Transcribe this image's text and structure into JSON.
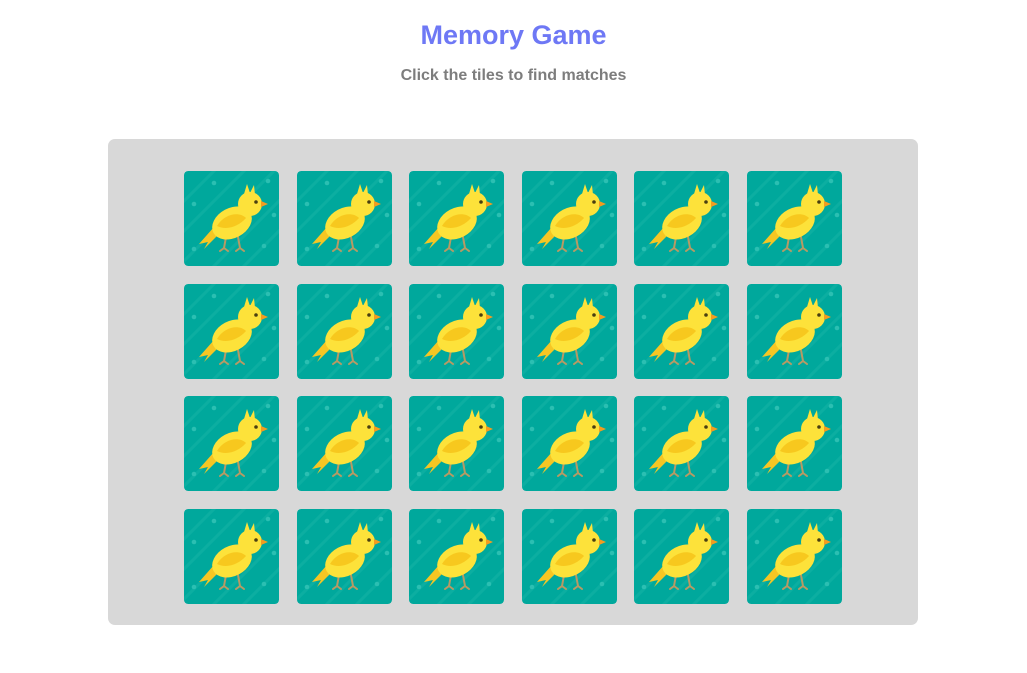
{
  "header": {
    "title": "Memory Game",
    "subtitle": "Click the tiles to find matches"
  },
  "board": {
    "rows": 4,
    "columns": 6,
    "tiles": [
      {
        "face": "down",
        "back_icon": "canary-bird-icon"
      },
      {
        "face": "down",
        "back_icon": "canary-bird-icon"
      },
      {
        "face": "down",
        "back_icon": "canary-bird-icon"
      },
      {
        "face": "down",
        "back_icon": "canary-bird-icon"
      },
      {
        "face": "down",
        "back_icon": "canary-bird-icon"
      },
      {
        "face": "down",
        "back_icon": "canary-bird-icon"
      },
      {
        "face": "down",
        "back_icon": "canary-bird-icon"
      },
      {
        "face": "down",
        "back_icon": "canary-bird-icon"
      },
      {
        "face": "down",
        "back_icon": "canary-bird-icon"
      },
      {
        "face": "down",
        "back_icon": "canary-bird-icon"
      },
      {
        "face": "down",
        "back_icon": "canary-bird-icon"
      },
      {
        "face": "down",
        "back_icon": "canary-bird-icon"
      },
      {
        "face": "down",
        "back_icon": "canary-bird-icon"
      },
      {
        "face": "down",
        "back_icon": "canary-bird-icon"
      },
      {
        "face": "down",
        "back_icon": "canary-bird-icon"
      },
      {
        "face": "down",
        "back_icon": "canary-bird-icon"
      },
      {
        "face": "down",
        "back_icon": "canary-bird-icon"
      },
      {
        "face": "down",
        "back_icon": "canary-bird-icon"
      },
      {
        "face": "down",
        "back_icon": "canary-bird-icon"
      },
      {
        "face": "down",
        "back_icon": "canary-bird-icon"
      },
      {
        "face": "down",
        "back_icon": "canary-bird-icon"
      },
      {
        "face": "down",
        "back_icon": "canary-bird-icon"
      },
      {
        "face": "down",
        "back_icon": "canary-bird-icon"
      },
      {
        "face": "down",
        "back_icon": "canary-bird-icon"
      }
    ]
  },
  "colors": {
    "title": "#6e78f5",
    "subtitle": "#7d7d7d",
    "board_background": "#d8d8d8",
    "tile_background": "#00a89c",
    "bird_body": "#fde23a",
    "bird_wing": "#f7c81e"
  }
}
